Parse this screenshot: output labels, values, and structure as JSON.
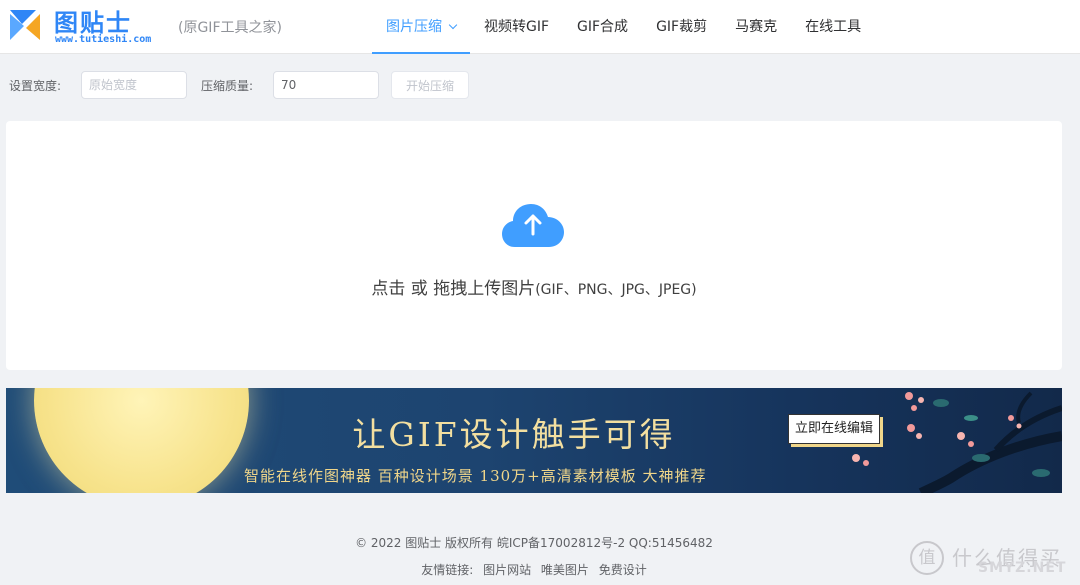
{
  "header": {
    "brand": "图贴士",
    "domain": "www.tutieshi.com",
    "tagline": "(原GIF工具之家)",
    "nav": [
      {
        "label": "图片压缩",
        "active": true
      },
      {
        "label": "视频转GIF"
      },
      {
        "label": "GIF合成"
      },
      {
        "label": "GIF裁剪"
      },
      {
        "label": "马赛克"
      },
      {
        "label": "在线工具"
      }
    ]
  },
  "toolbar": {
    "width_label": "设置宽度:",
    "width_placeholder": "原始宽度",
    "quality_label": "压缩质量:",
    "quality_value": "70",
    "start_button": "开始压缩"
  },
  "upload": {
    "text": "点击 或 拖拽上传图片",
    "formats": "(GIF、PNG、JPG、JPEG)",
    "icon": "cloud-upload-icon",
    "accent": "#409eff"
  },
  "banner": {
    "title": "让GIF设计触手可得",
    "subtitle": "智能在线作图神器  百种设计场景 130万+高清素材模板  大神推荐",
    "button": "立即在线编辑"
  },
  "footer": {
    "copyright": "© 2022 图贴士 版权所有 皖ICP备17002812号-2 QQ:51456482",
    "links_label": "友情链接:",
    "links": [
      "图片网站",
      "唯美图片",
      "免费设计"
    ]
  },
  "watermark": {
    "icon_char": "值",
    "text": "什么值得买",
    "sub": "SMYZ.NET"
  }
}
